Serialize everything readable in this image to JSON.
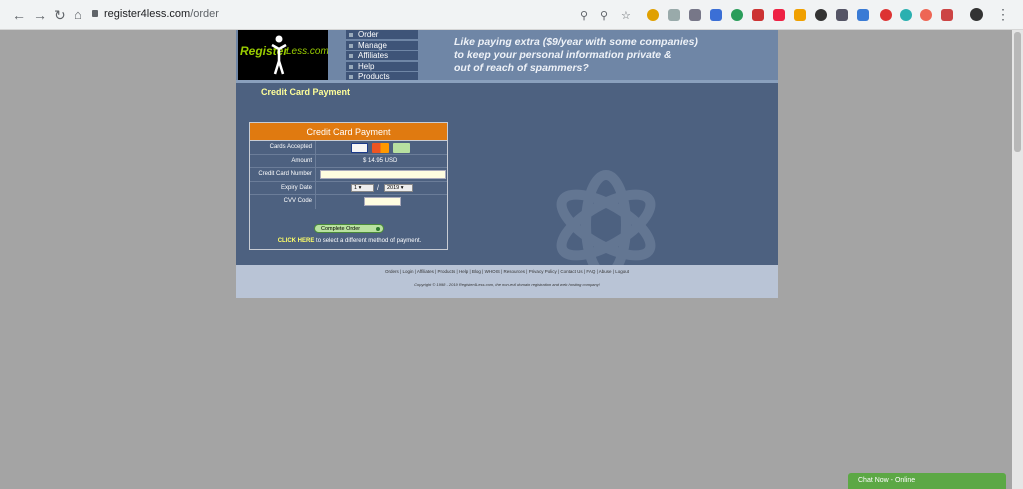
{
  "browser": {
    "url_host": "register4less.com",
    "url_path": "/order"
  },
  "site": {
    "logo_register": "Register",
    "logo_less": "Less.com",
    "nav": [
      "Order",
      "Manage",
      "Affiliates",
      "Help",
      "Products"
    ],
    "slogan_line1": "Like paying extra ($9/year with some companies)",
    "slogan_line2": "to keep your personal information private &",
    "slogan_line3": "out of reach of spammers?",
    "page_title": "Credit Card Payment"
  },
  "payment": {
    "heading": "Credit Card Payment",
    "labels": {
      "cards": "Cards Accepted",
      "amount": "Amount",
      "number": "Credit Card Number",
      "expiry": "Expiry Date",
      "cvv": "CVV Code"
    },
    "amount": "$ 14.95 USD",
    "expiry_month": "1",
    "expiry_sep": "/",
    "expiry_year": "2019",
    "complete_button": "Complete Order",
    "click_here": "CLICK HERE",
    "click_here_rest": " to select a different method of payment."
  },
  "footer": {
    "links": [
      "Orders",
      "Login",
      "Affiliates",
      "Products",
      "Help",
      "Blog",
      "WHOIS",
      "Resources",
      "Privacy Policy",
      "Contact Us",
      "FAQ",
      "Abuse",
      "Logout"
    ],
    "copyright": "Copyright © 1998 - 2019 Register4Less.com, the non-evil domain registration and web hosting company!"
  },
  "chat": {
    "label": "Chat Now - Online"
  },
  "colors": {
    "page_bg": "#a4a4a4",
    "site_bg": "#4d6180",
    "panel_header": "#e07a10",
    "title_yellow": "#ffff99",
    "chat_green": "#5ca845"
  }
}
